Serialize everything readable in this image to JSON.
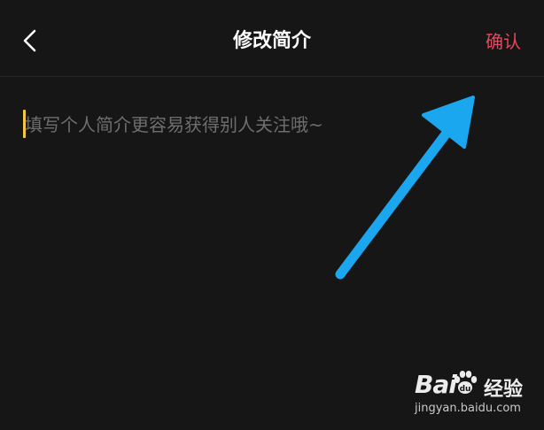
{
  "header": {
    "title": "修改简介",
    "confirm_label": "确认",
    "back_icon": "chevron-left-icon"
  },
  "bio_input": {
    "placeholder": "填写个人简介更容易获得别人关注哦~",
    "value": ""
  },
  "overlay": {
    "arrow_color": "#1aa7f0"
  },
  "watermark": {
    "brand_left": "Bai",
    "brand_right": "经验",
    "domain": "jingyan.baidu.com"
  },
  "colors": {
    "background": "#161616",
    "confirm": "#e8475d",
    "caret": "#f5c644",
    "placeholder": "#6e6e6e"
  }
}
